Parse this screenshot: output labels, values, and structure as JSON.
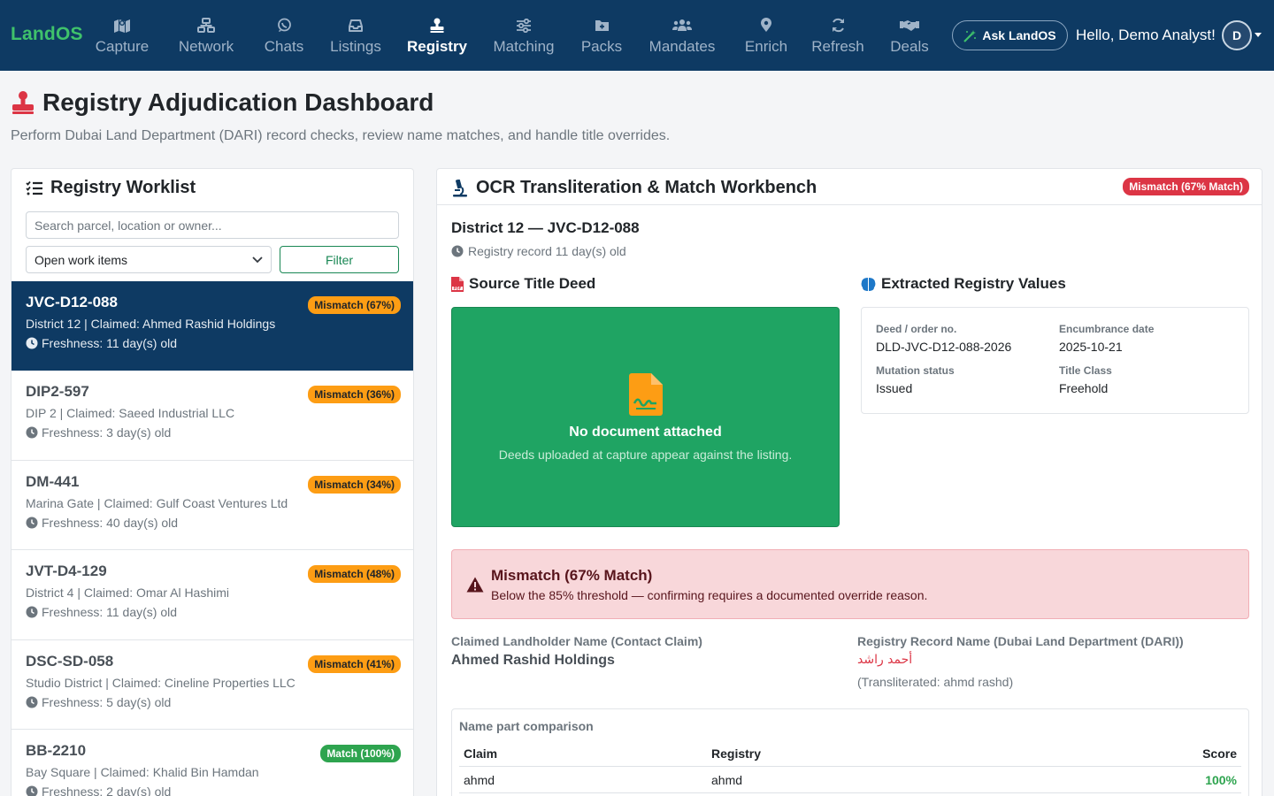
{
  "nav": {
    "brand": "LandOS",
    "items": [
      {
        "label": "Capture",
        "icon": "map-location-icon"
      },
      {
        "label": "Network",
        "icon": "network-icon"
      },
      {
        "label": "Chats",
        "icon": "whatsapp-icon"
      },
      {
        "label": "Listings",
        "icon": "inbox-icon"
      },
      {
        "label": "Registry",
        "icon": "stamp-icon",
        "active": true
      },
      {
        "label": "Matching",
        "icon": "sliders-icon"
      },
      {
        "label": "Packs",
        "icon": "folder-plus-icon"
      },
      {
        "label": "Mandates",
        "icon": "users-icon"
      },
      {
        "label": "Enrich",
        "icon": "map-pin-icon"
      },
      {
        "label": "Refresh",
        "icon": "refresh-icon"
      },
      {
        "label": "Deals",
        "icon": "handshake-icon"
      }
    ],
    "ask_label": "Ask LandOS",
    "greeting": "Hello, Demo Analyst!",
    "avatar_initial": "D"
  },
  "header": {
    "title": "Registry Adjudication Dashboard",
    "subtitle": "Perform Dubai Land Department (DARI) record checks, review name matches, and handle title overrides."
  },
  "worklist": {
    "title": "Registry Worklist",
    "search_placeholder": "Search parcel, location or owner...",
    "select_value": "Open work items",
    "filter_label": "Filter",
    "items": [
      {
        "id": "JVC-D12-088",
        "line": "District 12 | Claimed: Ahmed Rashid Holdings",
        "freshness": "Freshness: 11 day(s) old",
        "badge": "Mismatch (67%)",
        "status": "warn",
        "active": true
      },
      {
        "id": "DIP2-597",
        "line": "DIP 2 | Claimed: Saeed Industrial LLC",
        "freshness": "Freshness: 3 day(s) old",
        "badge": "Mismatch (36%)",
        "status": "warn"
      },
      {
        "id": "DM-441",
        "line": "Marina Gate | Claimed: Gulf Coast Ventures Ltd",
        "freshness": "Freshness: 40 day(s) old",
        "badge": "Mismatch (34%)",
        "status": "warn"
      },
      {
        "id": "JVT-D4-129",
        "line": "District 4 | Claimed: Omar Al Hashimi",
        "freshness": "Freshness: 11 day(s) old",
        "badge": "Mismatch (48%)",
        "status": "warn"
      },
      {
        "id": "DSC-SD-058",
        "line": "Studio District | Claimed: Cineline Properties LLC",
        "freshness": "Freshness: 5 day(s) old",
        "badge": "Mismatch (41%)",
        "status": "warn"
      },
      {
        "id": "BB-2210",
        "line": "Bay Square | Claimed: Khalid Bin Hamdan",
        "freshness": "Freshness: 2 day(s) old",
        "badge": "Match (100%)",
        "status": "ok"
      }
    ]
  },
  "workbench": {
    "title": "OCR Transliteration & Match Workbench",
    "badge": "Mismatch (67% Match)",
    "record_title": "District 12 — JVC-D12-088",
    "record_age": "Registry record 11 day(s) old",
    "deed": {
      "title": "Source Title Deed",
      "empty_title": "No document attached",
      "empty_text": "Deeds uploaded at capture appear against the listing."
    },
    "values": {
      "title": "Extracted Registry Values",
      "deed_no_label": "Deed / order no.",
      "deed_no": "DLD-JVC-D12-088-2026",
      "encumbrance_label": "Encumbrance date",
      "encumbrance": "2025-10-21",
      "mutation_label": "Mutation status",
      "mutation": "Issued",
      "title_class_label": "Title Class",
      "title_class": "Freehold"
    },
    "alert": {
      "title": "Mismatch (67% Match)",
      "text": "Below the 85% threshold — confirming requires a documented override reason."
    },
    "claim": {
      "label": "Claimed Landholder Name (Contact Claim)",
      "value": "Ahmed Rashid Holdings"
    },
    "registry": {
      "label": "Registry Record Name (Dubai Land Department (DARI))",
      "arabic": "أحمد راشد",
      "translit": "(Transliterated: ahmd rashd)"
    },
    "comparison": {
      "title": "Name part comparison",
      "headers": {
        "claim": "Claim",
        "registry": "Registry",
        "score": "Score"
      },
      "rows": [
        {
          "claim": "ahmd",
          "registry": "ahmd",
          "score": "100%"
        }
      ]
    }
  },
  "colors": {
    "nav_bg": "#0e3a63",
    "brand": "#3fc26b",
    "warn_badge": "#fd9d14",
    "ok_badge": "#2ea44f",
    "danger": "#dc3545",
    "doc_green": "#1fa463"
  }
}
